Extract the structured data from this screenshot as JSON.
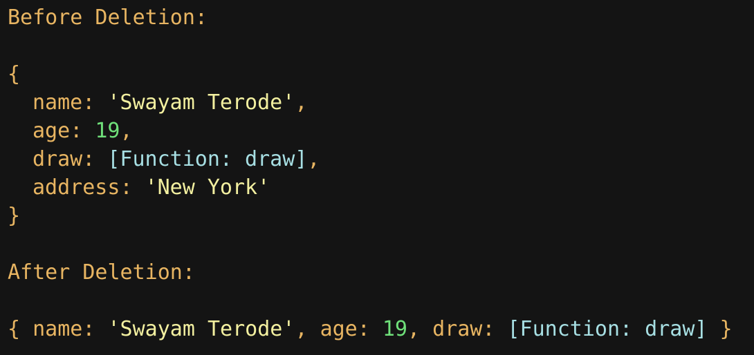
{
  "before": {
    "heading": "Before Deletion:",
    "open_brace": "{",
    "close_brace": "}",
    "properties": [
      {
        "key": "name",
        "value": "'Swayam Terode'",
        "type": "string"
      },
      {
        "key": "age",
        "value": "19",
        "type": "number"
      },
      {
        "key": "draw",
        "value": "[Function: draw]",
        "type": "function"
      },
      {
        "key": "address",
        "value": "'New York'",
        "type": "string"
      }
    ]
  },
  "after": {
    "heading": "After Deletion:",
    "open_brace": "{",
    "close_brace": "}",
    "properties": [
      {
        "key": "name",
        "value": "'Swayam Terode'",
        "type": "string"
      },
      {
        "key": "age",
        "value": "19",
        "type": "number"
      },
      {
        "key": "draw",
        "value": "[Function: draw]",
        "type": "function"
      }
    ]
  },
  "colors": {
    "background": "#141414",
    "key": "#e8b562",
    "string": "#f3f0a0",
    "number": "#6fe07a",
    "function": "#a7dfe3"
  }
}
